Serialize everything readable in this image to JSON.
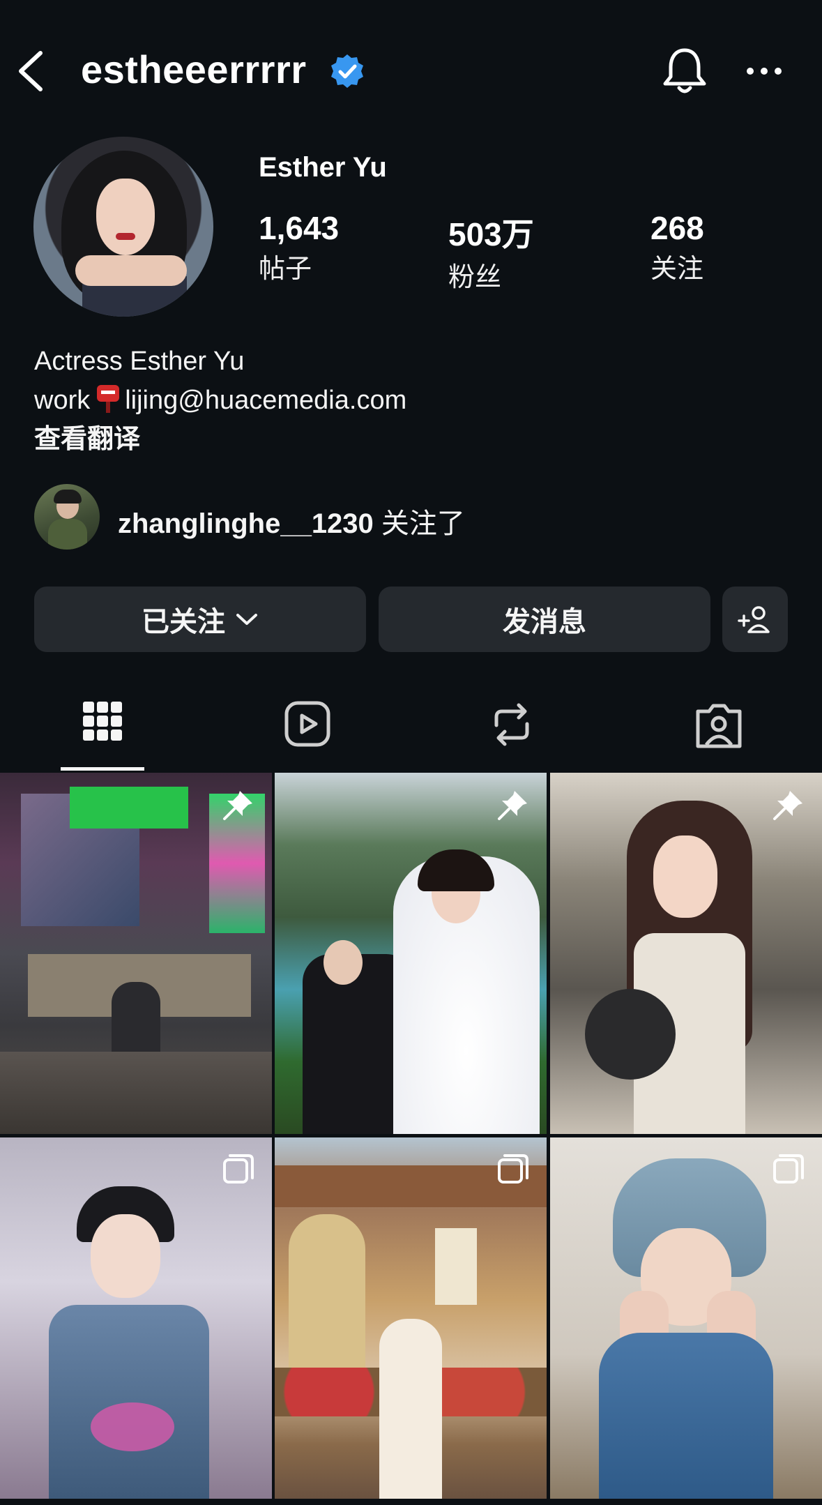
{
  "header": {
    "username": "estheeerrrrr",
    "verified_icon": "verified-badge-icon",
    "accent": "#3897f0"
  },
  "profile": {
    "full_name": "Esther Yu",
    "stats": [
      {
        "value": "1,643",
        "label": "帖子"
      },
      {
        "value": "503万",
        "label": "粉丝"
      },
      {
        "value": "268",
        "label": "关注"
      }
    ],
    "bio_line1": "Actress Esther Yu",
    "bio_work": "work",
    "bio_email": "lijing@huacemedia.com",
    "translate": "查看翻译"
  },
  "mutual": {
    "username": "zhanglinghe__1230",
    "suffix": "关注了"
  },
  "actions": {
    "following": "已关注",
    "message": "发消息"
  },
  "tabs": [
    {
      "icon": "grid-icon",
      "active": true
    },
    {
      "icon": "reels-icon",
      "active": false
    },
    {
      "icon": "repost-icon",
      "active": false
    },
    {
      "icon": "tagged-icon",
      "active": false
    }
  ],
  "posts": [
    {
      "kind": "pinned"
    },
    {
      "kind": "pinned"
    },
    {
      "kind": "pinned"
    },
    {
      "kind": "carousel"
    },
    {
      "kind": "carousel"
    },
    {
      "kind": "carousel"
    }
  ]
}
